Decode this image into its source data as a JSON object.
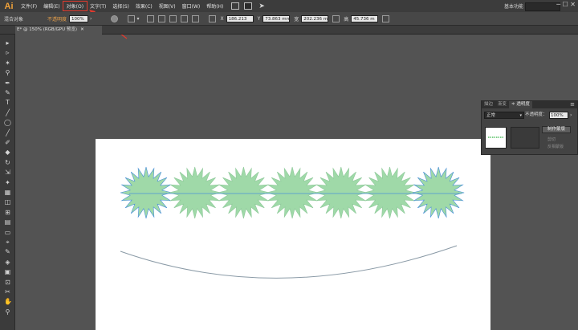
{
  "app": {
    "logo": "Ai",
    "workspace": "基本功能",
    "window_controls": "─  ☐  ✕"
  },
  "menu": [
    {
      "label": "文件(F)",
      "active": false
    },
    {
      "label": "编辑(E)",
      "active": false
    },
    {
      "label": "对象(O)",
      "active": true
    },
    {
      "label": "文字(T)",
      "active": false
    },
    {
      "label": "选择(S)",
      "active": false
    },
    {
      "label": "效果(C)",
      "active": false
    },
    {
      "label": "视图(V)",
      "active": false
    },
    {
      "label": "窗口(W)",
      "active": false
    },
    {
      "label": "帮助(H)",
      "active": false
    }
  ],
  "control_bar": {
    "left_label": "混合对象",
    "opacity_label": "不透明度",
    "opacity_value": "100%",
    "x_label": "X",
    "x_value": "186.213",
    "y_label": "Y",
    "y_value": "73.863 mm",
    "w_label": "宽",
    "w_value": "202.236 m",
    "h_label": "高",
    "h_value": "45.736 m"
  },
  "document_tab": {
    "title": "E* @ 150% (RGB/GPU 预览)",
    "close": "✕"
  },
  "tools": [
    "▸",
    "▹",
    "✶",
    "⚲",
    "✒",
    "✎",
    "T",
    "╱",
    "◯",
    "╱",
    "✐",
    "◆",
    "↻",
    "⇲",
    "✦",
    "▦",
    "◫",
    "⊞",
    "▤",
    "▭",
    "⌖",
    "✎",
    "◈",
    "▣",
    "⊡",
    "✂",
    "✋",
    "⚲"
  ],
  "transparency_panel": {
    "tabs": [
      "描边",
      "渐变",
      "≑ 透明度"
    ],
    "active_tab": 2,
    "menu_icon": "≡",
    "blend_mode": "正常",
    "opacity_label": "不透明度：",
    "opacity_value": "100%",
    "button_label": "制作蒙版",
    "clip_label": "剪切",
    "invert_label": "反相蒙版"
  },
  "colors": {
    "ui_dark": "#3c3c3c",
    "canvas": "#535353",
    "highlight": "#e23a2e",
    "star_fill": "#9fd9a8",
    "selection": "#4a90d9"
  },
  "star_count": 7
}
